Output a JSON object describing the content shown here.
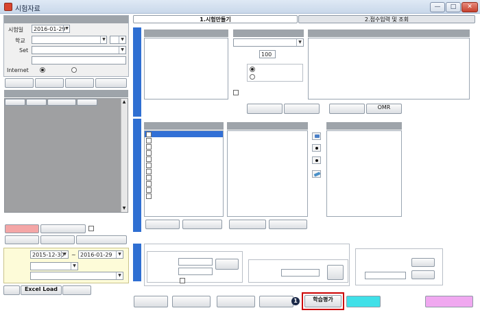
{
  "window": {
    "title": "시험자료",
    "min_label": "—",
    "max_label": "□",
    "close_label": "✕"
  },
  "tabs": [
    {
      "label": "1.시험만들기",
      "active": true
    },
    {
      "label": "2.점수입력 및 조회",
      "active": false
    }
  ],
  "left": {
    "exam_header": "",
    "date_label": "시험일",
    "date_value": "2016-01-29",
    "school_label": "학교",
    "set_label": "Set",
    "small_label": "",
    "internet_label": "Internet",
    "radio_1": "",
    "radio_2": "",
    "buttons": [
      "",
      "",
      "",
      ""
    ],
    "list_header": "",
    "list_columns": [
      "",
      "",
      "",
      ""
    ],
    "bottom_buttons": [
      "",
      "",
      "",
      "",
      ""
    ],
    "bottom_check": "",
    "period_label": "",
    "period_start": "2015-12-30",
    "period_sep": "~",
    "period_end": "2016-01-29",
    "set2_label": "",
    "set2_value": "",
    "school2_label": "",
    "footer_tabs": [
      "",
      "Excel Load",
      "",
      ""
    ]
  },
  "top_section": {
    "col1_header": "",
    "col2_header": "",
    "col3_header": "",
    "points_label": "",
    "points_value": "100",
    "type_label": "",
    "type_options": [
      "",
      ""
    ],
    "omr_check": "",
    "buttons": [
      "",
      "",
      "",
      "OMR"
    ]
  },
  "mid_section": {
    "col1_header": "",
    "col2_header": "",
    "col3_header": "",
    "items": [
      "",
      "",
      "",
      "",
      "",
      "",
      "",
      "",
      "",
      "",
      ""
    ],
    "left_buttons": [
      "",
      ""
    ],
    "right_buttons": [
      "",
      ""
    ]
  },
  "bottom_section": {
    "header": "",
    "sub_header": "",
    "fields": [
      "",
      ""
    ],
    "confirm_button": "",
    "check_label": "",
    "right_header": "",
    "right_sub": "",
    "current_label": "",
    "side_button": "",
    "score_header": "",
    "score_label": "",
    "score_buttons": [
      "",
      ""
    ]
  },
  "footer": {
    "buttons": [
      "",
      "",
      "",
      "",
      "학습평가",
      "",
      ""
    ],
    "marker": "1"
  },
  "colors": {
    "accent_tab": "#2f6fd2",
    "highlight_red": "#cc0000",
    "pink_button": "#f4a6a6",
    "cyan_button": "#40e0e8",
    "magenta_button": "#f0a8f0"
  }
}
